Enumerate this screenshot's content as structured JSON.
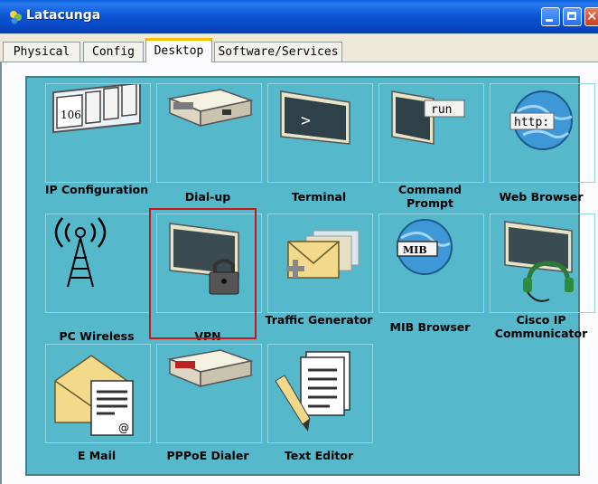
{
  "window": {
    "title": "Latacunga"
  },
  "tabs": [
    {
      "label": "Physical"
    },
    {
      "label": "Config"
    },
    {
      "label": "Desktop"
    },
    {
      "label": "Software/Services"
    }
  ],
  "active_tab": "Desktop",
  "apps": [
    {
      "label": "IP Configuration",
      "icon": "ip-configuration-icon"
    },
    {
      "label": "Dial-up",
      "icon": "modem-icon"
    },
    {
      "label": "Terminal",
      "icon": "terminal-icon"
    },
    {
      "label": "Command Prompt",
      "icon": "command-prompt-icon"
    },
    {
      "label": "Web Browser",
      "icon": "web-browser-icon"
    },
    {
      "label": "PC Wireless",
      "icon": "wireless-antenna-icon"
    },
    {
      "label": "VPN",
      "icon": "vpn-lock-monitor-icon"
    },
    {
      "label": "Traffic Generator",
      "icon": "traffic-generator-icon"
    },
    {
      "label": "MIB Browser",
      "icon": "mib-browser-icon"
    },
    {
      "label": "Cisco IP Communicator",
      "icon": "ip-communicator-icon"
    },
    {
      "label": "E Mail",
      "icon": "email-icon"
    },
    {
      "label": "PPPoE Dialer",
      "icon": "pppoe-dialer-icon"
    },
    {
      "label": "Text Editor",
      "icon": "text-editor-icon"
    }
  ],
  "icon_text": {
    "ip": "106",
    "cmd": "run",
    "web": "http:",
    "mib": "MIB",
    "email": "@",
    "terminal": ">"
  },
  "highlighted_app": "VPN",
  "colors": {
    "desktop_bg": "#56b8cb",
    "titlebar": "#0846c2",
    "highlight": "#cc1515"
  }
}
